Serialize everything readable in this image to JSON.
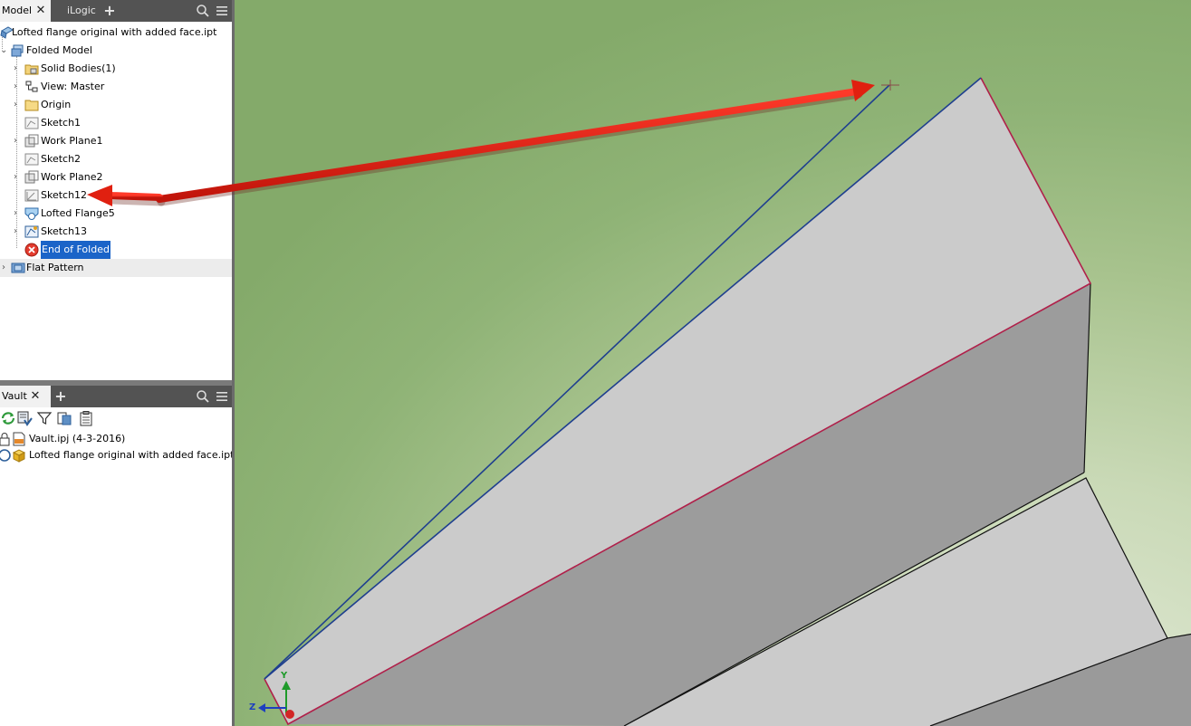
{
  "model_panel": {
    "tabs": [
      {
        "label": "Model",
        "active": true
      },
      {
        "label": "iLogic",
        "active": false
      }
    ],
    "tab_close": "✕",
    "tab_add": "+",
    "document_title": "Lofted flange original with added face.ipt",
    "tree": {
      "folded_model": "Folded Model",
      "items": [
        {
          "label": "Solid Bodies(1)",
          "icon": "solid-bodies-folder-icon"
        },
        {
          "label": "View: Master",
          "icon": "view-icon"
        },
        {
          "label": "Origin",
          "icon": "origin-folder-icon"
        },
        {
          "label": "Sketch1",
          "icon": "sketch-icon"
        },
        {
          "label": "Work Plane1",
          "icon": "work-plane-icon"
        },
        {
          "label": "Sketch2",
          "icon": "sketch-icon"
        },
        {
          "label": "Work Plane2",
          "icon": "work-plane-icon"
        },
        {
          "label": "Sketch12",
          "icon": "sketch-icon"
        },
        {
          "label": "Lofted Flange5",
          "icon": "lofted-flange-icon"
        },
        {
          "label": "Sketch13",
          "icon": "sketch-icon"
        },
        {
          "label": "End of Folded",
          "icon": "end-of-part-icon"
        }
      ],
      "flat_pattern": "Flat Pattern"
    }
  },
  "vault_panel": {
    "tab": "Vault",
    "tab_close": "✕",
    "tab_add": "+",
    "items": [
      {
        "label": "Vault.ipj (4-3-2016)",
        "icon": "project-file-icon"
      },
      {
        "label": "Lofted flange original with added face.ipt*",
        "icon": "part-file-icon"
      }
    ]
  },
  "viewport": {
    "axis_y": "Y",
    "axis_z": "Z"
  },
  "colors": {
    "panel_tab_bg": "#535353",
    "selection": "#1b64c8",
    "annotation_arrow": "#e02010",
    "sketch_line": "#1f3f8f",
    "edge_highlight": "#b0204a",
    "face_light": "#cbcbcb",
    "face_dark": "#9b9b9b"
  }
}
